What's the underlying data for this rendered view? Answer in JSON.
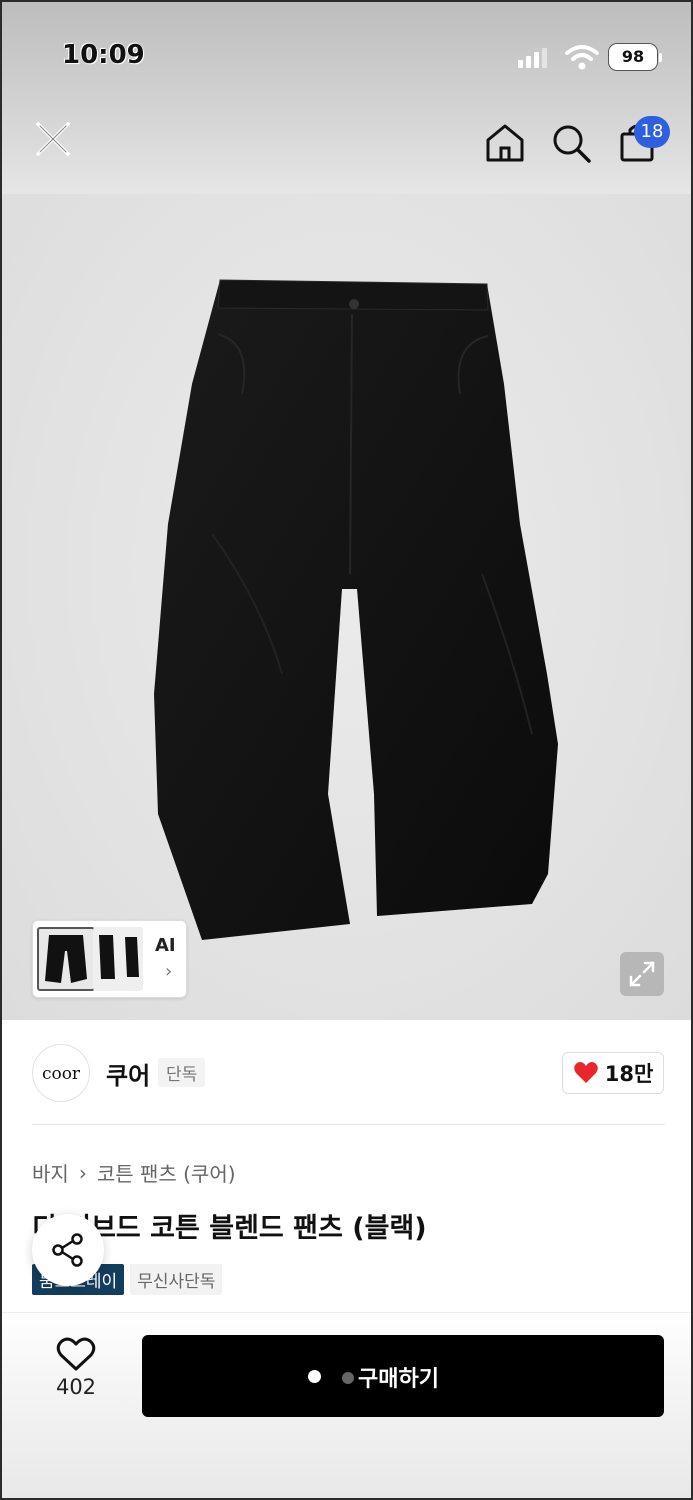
{
  "status_bar": {
    "time": "10:09",
    "battery": "98"
  },
  "nav": {
    "cart_count": "18"
  },
  "gallery": {
    "ai_label": "AI",
    "ai_chevron": "›"
  },
  "brand": {
    "logo_text": "coor",
    "name": "쿠어",
    "tag": "단독",
    "likes": "18만"
  },
  "breadcrumb": {
    "category": "바지",
    "separator": "›",
    "subcategory": "코튼 팬츠 (쿠어)"
  },
  "product": {
    "title": "디 리브드 코튼 블렌드 팬츠 (블랙)",
    "badges": [
      "뭄스트레이",
      "무신사단독"
    ]
  },
  "bottom_bar": {
    "wish_count": "402",
    "buy_label": "구매하기"
  },
  "colors": {
    "accent_blue": "#2f5fe0",
    "badge_navy": "#123d5c",
    "heart_red": "#e8262c",
    "buy_button": "#000000"
  },
  "icons": [
    "close-icon",
    "home-icon",
    "search-icon",
    "cart-icon",
    "expand-icon",
    "heart-icon",
    "share-icon",
    "chevron-right-icon"
  ]
}
